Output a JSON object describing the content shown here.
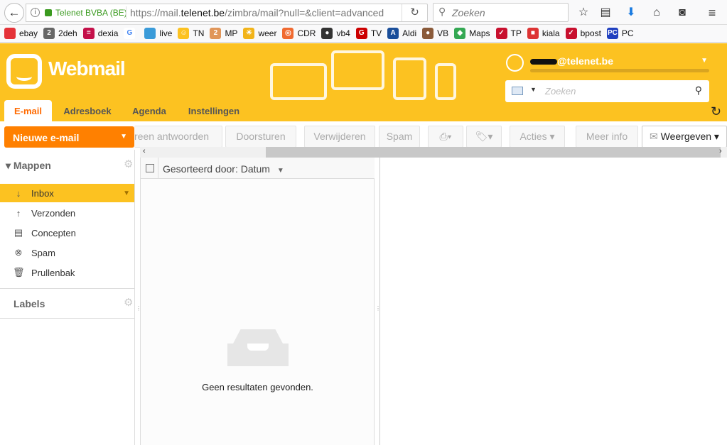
{
  "browser": {
    "site_identity": "Telenet BVBA (BE)",
    "url_prefix": "https://mail.",
    "url_domain": "telenet.be",
    "url_rest": "/zimbra/mail?null=&client=advanced",
    "search_placeholder": "Zoeken"
  },
  "bookmarks": [
    {
      "label": "ebay",
      "color": "#e53238",
      "glyph": ""
    },
    {
      "label": "2deh",
      "color": "#666",
      "glyph": "2"
    },
    {
      "label": "dexia",
      "color": "#c4114a",
      "glyph": "="
    },
    {
      "label": "",
      "color": "#fff",
      "glyph": "G"
    },
    {
      "label": "live",
      "color": "#3a9bd9",
      "glyph": ""
    },
    {
      "label": "TN",
      "color": "#fcc221",
      "glyph": "☺"
    },
    {
      "label": "MP",
      "color": "#e0965a",
      "glyph": "2"
    },
    {
      "label": "weer",
      "color": "#f2b41a",
      "glyph": "☀"
    },
    {
      "label": "CDR",
      "color": "#f06a30",
      "glyph": "◎"
    },
    {
      "label": "vb4",
      "color": "#333",
      "glyph": "●"
    },
    {
      "label": "TV",
      "color": "#c00",
      "glyph": "G"
    },
    {
      "label": "Aldi",
      "color": "#1a4e9a",
      "glyph": "A"
    },
    {
      "label": "VB",
      "color": "#8a5a3a",
      "glyph": "●"
    },
    {
      "label": "Maps",
      "color": "#34a853",
      "glyph": "◆"
    },
    {
      "label": "TP",
      "color": "#c8102e",
      "glyph": "✓"
    },
    {
      "label": "kiala",
      "color": "#d33",
      "glyph": "■"
    },
    {
      "label": "bpost",
      "color": "#c8102e",
      "glyph": "✓"
    },
    {
      "label": "PC",
      "color": "#2040c0",
      "glyph": "PC"
    }
  ],
  "app": {
    "brand": "Webmail",
    "email_suffix": "@telenet.be",
    "search_placeholder": "Zoeken",
    "accent": "#fcc221",
    "new_color": "#ff8000"
  },
  "tabs": [
    "E-mail",
    "Adresboek",
    "Agenda",
    "Instellingen"
  ],
  "toolbar": {
    "new_mail": "Nieuwe e-mail",
    "reply_all": "reen antwoorden",
    "forward": "Doorsturen",
    "delete": "Verwijderen",
    "spam": "Spam",
    "actions": "Acties",
    "more_info": "Meer info",
    "view": "Weergeven"
  },
  "sidebar": {
    "folders_title": "Mappen",
    "folders": [
      {
        "label": "Inbox",
        "icon": "↓"
      },
      {
        "label": "Verzonden",
        "icon": "↑"
      },
      {
        "label": "Concepten",
        "icon": "▤"
      },
      {
        "label": "Spam",
        "icon": "⊗"
      },
      {
        "label": "Prullenbak",
        "icon": "🗑"
      }
    ],
    "labels_title": "Labels"
  },
  "list": {
    "sort_label": "Gesorteerd door: Datum",
    "empty": "Geen resultaten gevonden."
  }
}
